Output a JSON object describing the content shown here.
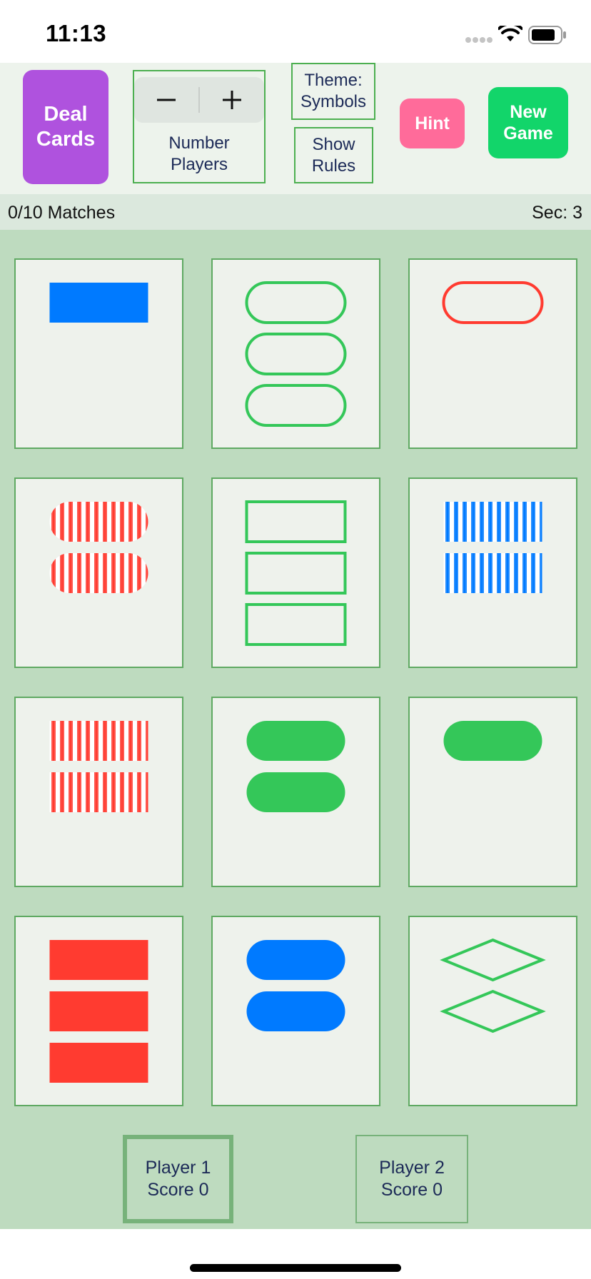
{
  "status_bar": {
    "time": "11:13",
    "icons": [
      "signal-dots-icon",
      "wifi-icon",
      "battery-icon"
    ]
  },
  "toolbar": {
    "deal_label": "Deal\nCards",
    "stepper_minus": "−",
    "stepper_plus": "+",
    "players_label": "Number\nPlayers",
    "theme_label": "Theme:\nSymbols",
    "rules_label": "Show\nRules",
    "hint_label": "Hint",
    "new_game_label": "New\nGame"
  },
  "info": {
    "matches": "0/10 Matches",
    "timer": "Sec: 3"
  },
  "colors": {
    "purple": "#af52de",
    "pink": "#ff6b9a",
    "green_button": "#12d56a",
    "card_blue": "#007aff",
    "card_green": "#34c759",
    "card_red": "#ff3b30",
    "board_bg": "#bedbbf",
    "card_bg": "#eef2ec"
  },
  "cards": [
    {
      "shape": "rectangle",
      "count": 1,
      "color": "blue",
      "fill": "solid"
    },
    {
      "shape": "capsule",
      "count": 3,
      "color": "green",
      "fill": "outline"
    },
    {
      "shape": "capsule",
      "count": 1,
      "color": "red",
      "fill": "outline"
    },
    {
      "shape": "capsule",
      "count": 2,
      "color": "red",
      "fill": "striped"
    },
    {
      "shape": "rectangle",
      "count": 3,
      "color": "green",
      "fill": "outline"
    },
    {
      "shape": "rectangle",
      "count": 2,
      "color": "blue",
      "fill": "striped"
    },
    {
      "shape": "rectangle",
      "count": 2,
      "color": "red",
      "fill": "striped"
    },
    {
      "shape": "capsule",
      "count": 2,
      "color": "green",
      "fill": "solid"
    },
    {
      "shape": "capsule",
      "count": 1,
      "color": "green",
      "fill": "solid"
    },
    {
      "shape": "rectangle",
      "count": 3,
      "color": "red",
      "fill": "solid"
    },
    {
      "shape": "capsule",
      "count": 2,
      "color": "blue",
      "fill": "solid"
    },
    {
      "shape": "diamond",
      "count": 2,
      "color": "green",
      "fill": "outline"
    }
  ],
  "players": [
    {
      "label": "Player 1\nScore 0",
      "active": true
    },
    {
      "label": "Player 2\nScore 0",
      "active": false
    }
  ]
}
